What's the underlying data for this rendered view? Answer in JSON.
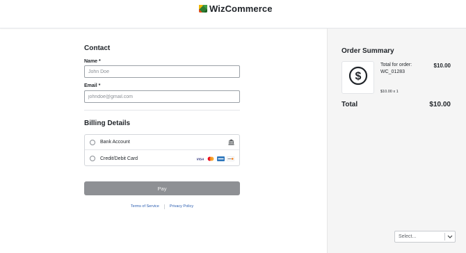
{
  "brand": {
    "name": "WizCommerce"
  },
  "contact": {
    "title": "Contact",
    "name_label": "Name",
    "name_placeholder": "John Doe",
    "email_label": "Email",
    "email_placeholder": "johndoe@gmail.com",
    "required_marker": "*"
  },
  "billing": {
    "title": "Billing Details",
    "options": [
      {
        "label": "Bank Account",
        "icon": "bank-icon",
        "selected": false
      },
      {
        "label": "Credit/Debit Card",
        "icons": [
          "visa-icon",
          "mastercard-icon",
          "amex-icon",
          "discover-icon"
        ],
        "selected": false
      }
    ]
  },
  "pay_button": {
    "label": "Pay",
    "disabled": true
  },
  "footer_links": {
    "terms": "Terms of Service",
    "privacy": "Privacy Policy"
  },
  "order_summary": {
    "title": "Order Summary",
    "item": {
      "name_line1": "Total for order:",
      "name_line2": "WC_01283",
      "price": "$10.00",
      "quantity": "$10.00 x 1",
      "icon": "dollar-icon"
    },
    "total_label": "Total",
    "total_value": "$10.00"
  },
  "language_select": {
    "placeholder": "Select..."
  },
  "colors": {
    "panel_bg": "#f5f5f5",
    "pay_button_bg": "#8e9094",
    "link": "#2a5db0"
  }
}
